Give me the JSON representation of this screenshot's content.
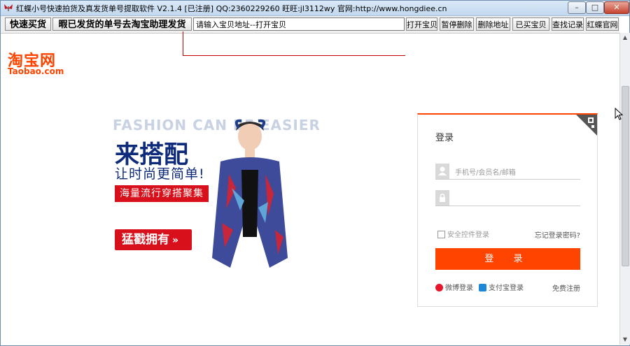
{
  "window": {
    "title": "红蝶小号快速拍货及真发货单号提取软件 V2.1.4 [已注册] QQ:2360229260 旺旺:jl3112wy 官网:http://www.hongdiee.cn",
    "controls": {
      "minimize": "–",
      "maximize": "□",
      "close": "✕"
    }
  },
  "toolbar": {
    "quick_buy": "快速买货",
    "ship_via_assistant": "暇已发货的单号去淘宝助理发货",
    "url_value": "请输入宝贝地址--打开宝贝",
    "open_item": "打开宝贝",
    "pause_delete": "暂停删除",
    "delete_address": "删除地址",
    "bought_items": "已买宝贝",
    "query_records": "查找记录",
    "official_site": "红蝶官网"
  },
  "page": {
    "logo_cn": "淘宝网",
    "logo_en": "Taobao.com",
    "banner": {
      "bg_text": "FASHION CAN BE EASIER",
      "headline": "来搭配",
      "subhead": "让时尚更简单!",
      "tag": "海量流行穿搭聚集",
      "cta": "猛戳拥有",
      "cta_arrow": "»"
    },
    "login": {
      "title": "登录",
      "username_placeholder": "手机号/会员名/邮箱",
      "password_placeholder": "",
      "safe_login": "安全控件登录",
      "forgot": "忘记登录密码?",
      "submit": "登 录",
      "weibo": "微博登录",
      "alipay": "支付宝登录",
      "register": "免费注册"
    }
  },
  "colors": {
    "taobao_orange": "#ff4400",
    "banner_red": "#d8101b",
    "banner_navy": "#0d2b7a"
  }
}
